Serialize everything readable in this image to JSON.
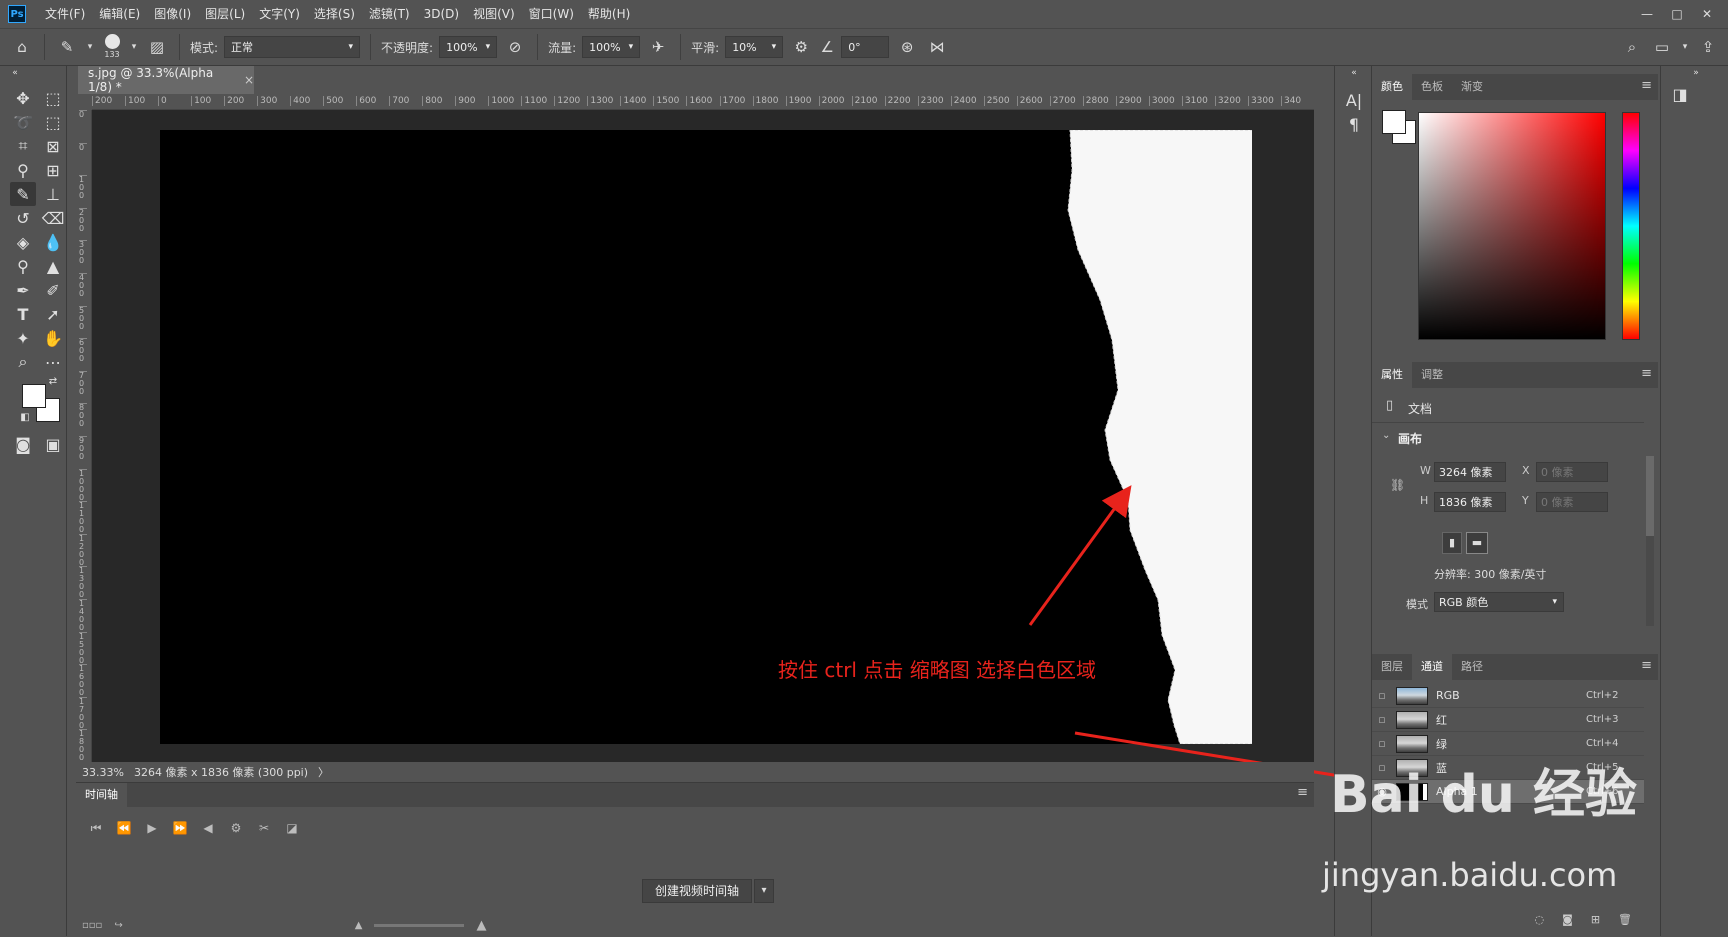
{
  "menubar": {
    "logo": "Ps",
    "items": [
      "文件(F)",
      "编辑(E)",
      "图像(I)",
      "图层(L)",
      "文字(Y)",
      "选择(S)",
      "滤镜(T)",
      "3D(D)",
      "视图(V)",
      "窗口(W)",
      "帮助(H)"
    ],
    "window_buttons": [
      "—",
      "□",
      "✕"
    ]
  },
  "options": {
    "brush_size": "133",
    "mode_label": "模式:",
    "mode_value": "正常",
    "opacity_label": "不透明度:",
    "opacity_value": "100%",
    "flow_label": "流量:",
    "flow_value": "100%",
    "smoothing_label": "平滑:",
    "smoothing_value": "10%",
    "angle_value": "0°"
  },
  "document": {
    "tab_title": "s.jpg @ 33.3%(Alpha 1/8) *",
    "tab_close": "×"
  },
  "ruler": {
    "h_ticks": [
      "200",
      "100",
      "0",
      "100",
      "200",
      "300",
      "400",
      "500",
      "600",
      "700",
      "800",
      "900",
      "1000",
      "1100",
      "1200",
      "1300",
      "1400",
      "1500",
      "1600",
      "1700",
      "1800",
      "1900",
      "2000",
      "2100",
      "2200",
      "2300",
      "2400",
      "2500",
      "2600",
      "2700",
      "2800",
      "2900",
      "3000",
      "3100",
      "3200",
      "3300",
      "340"
    ],
    "v_ticks": [
      "0",
      "0",
      "1 0 0",
      "2 0 0",
      "3 0 0",
      "4 0 0",
      "5 0 0",
      "6 0 0",
      "7 0 0",
      "8 0 0",
      "9 0 0",
      "1 0 0 0",
      "1 1 0 0",
      "1 2 0 0",
      "1 3 0 0",
      "1 4 0 0",
      "1 5 0 0",
      "1 6 0 0",
      "1 7 0 0",
      "1 8 0 0"
    ]
  },
  "annotation": {
    "text": "按住 ctrl 点击 缩略图 选择白色区域",
    "color": "#e8231c"
  },
  "status": {
    "zoom": "33.33%",
    "doc_info": "3264 像素 x 1836 像素 (300 ppi)",
    "arrow": "〉"
  },
  "timeline": {
    "tab": "时间轴",
    "create_button": "创建视频时间轴"
  },
  "color_panel": {
    "tabs": [
      "颜色",
      "色板",
      "渐变"
    ]
  },
  "properties_panel": {
    "tabs": [
      "属性",
      "调整"
    ],
    "doc_label": "文档",
    "section": "画布",
    "w_label": "W",
    "w_value": "3264 像素",
    "h_label": "H",
    "h_value": "1836 像素",
    "x_label": "X",
    "x_value": "0 像素",
    "y_label": "Y",
    "y_value": "0 像素",
    "resolution": "分辨率: 300 像素/英寸",
    "mode_label": "模式",
    "mode_value": "RGB 颜色"
  },
  "channels_panel": {
    "tabs": [
      "图层",
      "通道",
      "路径"
    ],
    "channels": [
      {
        "name": "RGB",
        "shortcut": "Ctrl+2"
      },
      {
        "name": "红",
        "shortcut": "Ctrl+3"
      },
      {
        "name": "绿",
        "shortcut": "Ctrl+4"
      },
      {
        "name": "蓝",
        "shortcut": "Ctrl+5"
      },
      {
        "name": "Alpha 1",
        "shortcut": "Ctrl+6"
      }
    ]
  },
  "watermark": {
    "brand": "Bai du 经验",
    "url": "jingyan.baidu.com"
  }
}
